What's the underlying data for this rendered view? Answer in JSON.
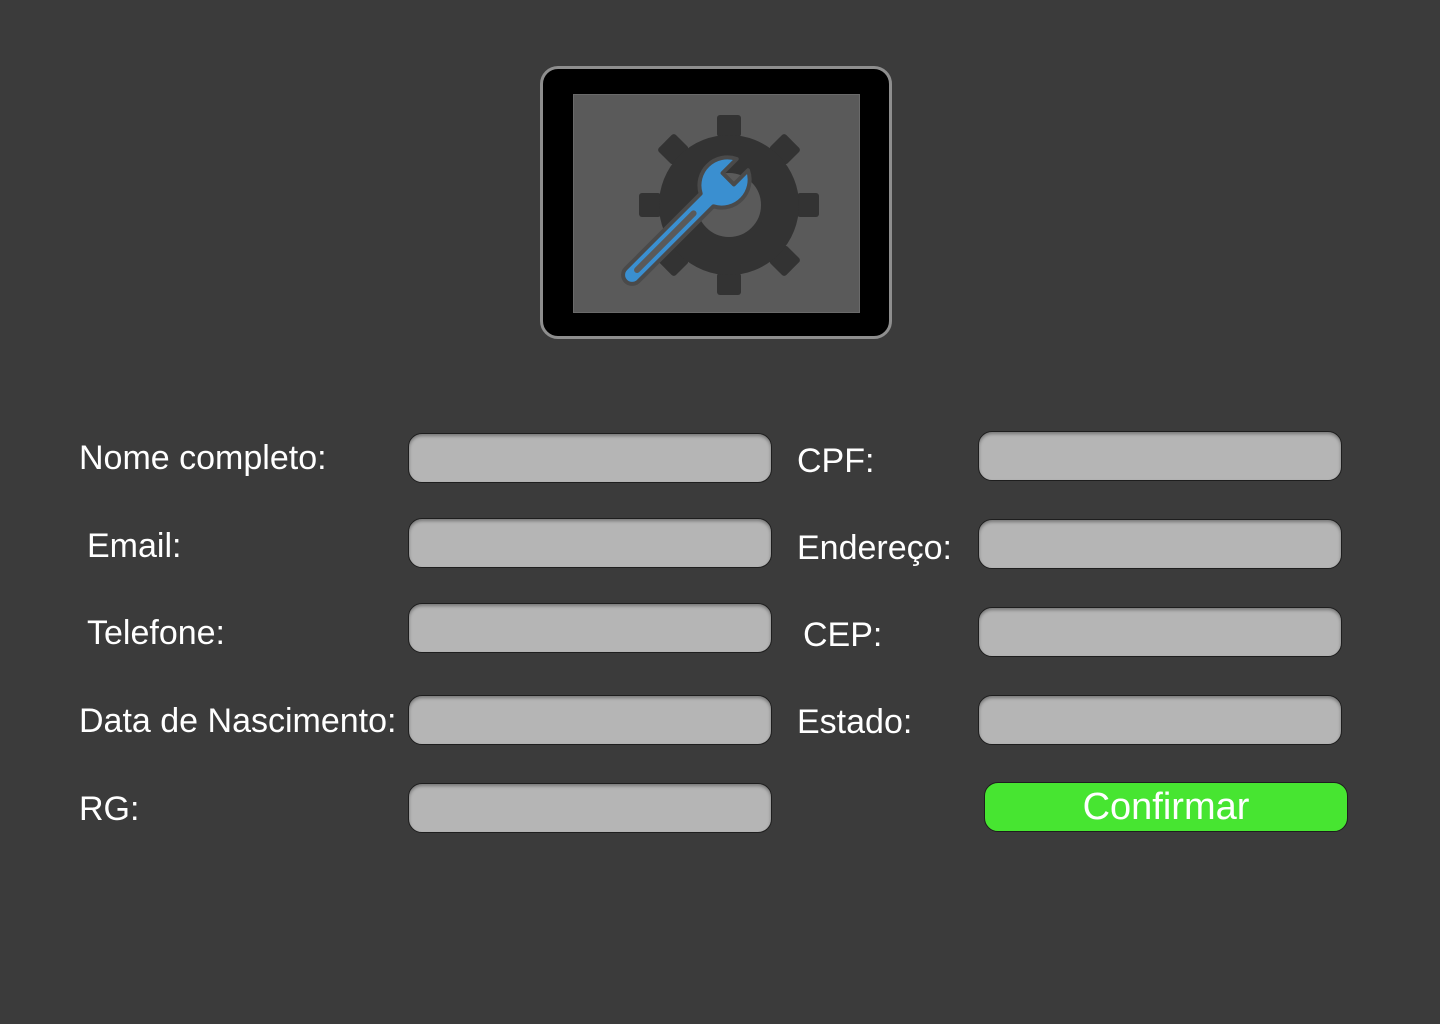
{
  "logo": {
    "icon": "gear-wrench-icon",
    "gear_color": "#333333",
    "wrench_color": "#3a8fd0"
  },
  "form": {
    "left_fields": [
      {
        "label": "Nome completo:",
        "value": ""
      },
      {
        "label": "Email:",
        "value": ""
      },
      {
        "label": "Telefone:",
        "value": ""
      },
      {
        "label": "Data de Nascimento:",
        "value": ""
      },
      {
        "label": "RG:",
        "value": ""
      }
    ],
    "right_fields": [
      {
        "label": "CPF:",
        "value": ""
      },
      {
        "label": "Endereço:",
        "value": ""
      },
      {
        "label": "CEP:",
        "value": ""
      },
      {
        "label": "Estado:",
        "value": ""
      }
    ],
    "confirm_label": "Confirmar"
  },
  "colors": {
    "background": "#3b3b3b",
    "field": "#b5b5b5",
    "confirm": "#47e531"
  }
}
